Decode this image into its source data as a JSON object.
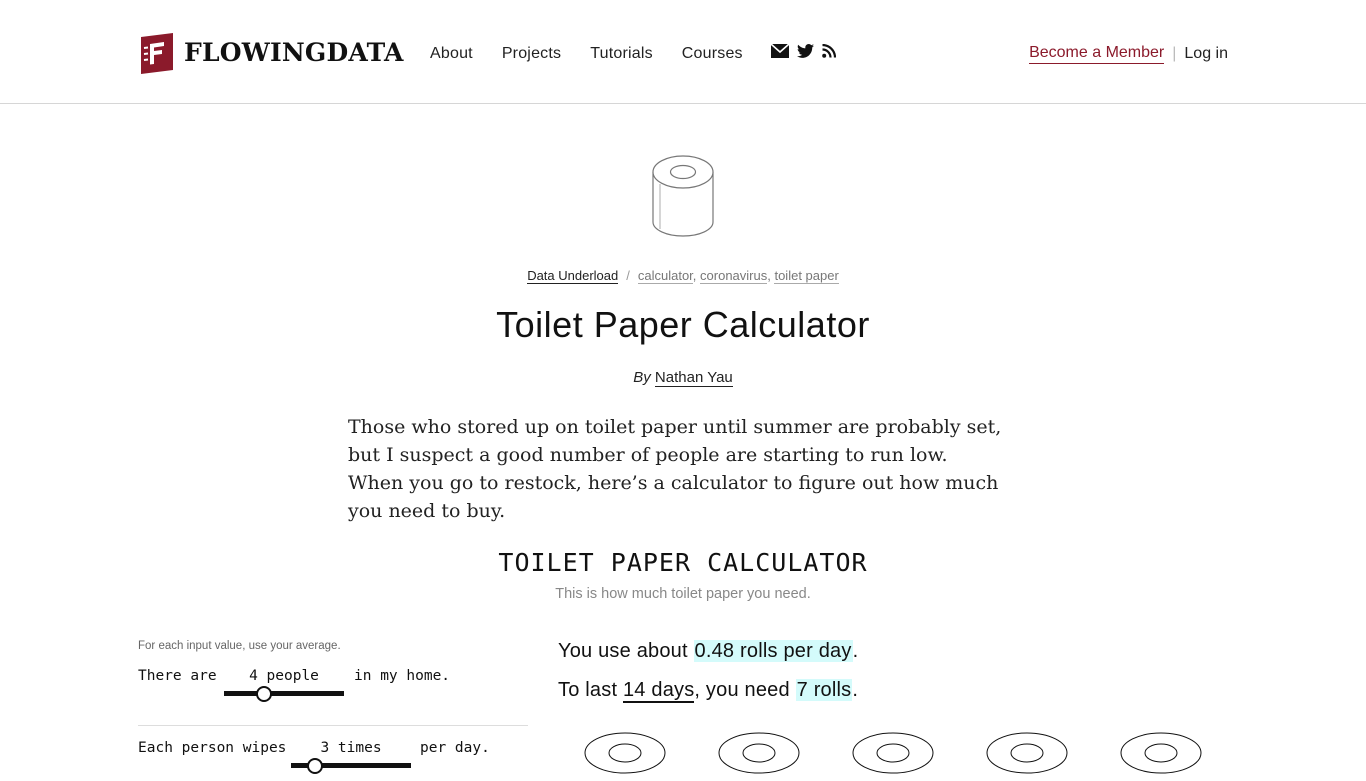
{
  "header": {
    "logo_text": "FLOWINGDATA",
    "nav": [
      "About",
      "Projects",
      "Tutorials",
      "Courses"
    ],
    "icons": [
      "mail-icon",
      "twitter-icon",
      "rss-icon"
    ],
    "become_member": "Become a Member",
    "separator": "|",
    "login": "Log in",
    "brand_color": "#8b1a2b"
  },
  "article": {
    "category": "Data Underload",
    "slash": "/",
    "tags": [
      "calculator",
      "coronavirus",
      "toilet paper"
    ],
    "title": "Toilet Paper Calculator",
    "by_label": "By",
    "author": "Nathan Yau",
    "intro": "Those who stored up on toilet paper until summer are probably set, but I suspect a good number of people are starting to run low. When you go to restock, here’s a calculator to figure out how much you need to buy."
  },
  "calculator": {
    "title": "TOILET PAPER CALCULATOR",
    "subtitle": "This is how much toilet paper you need.",
    "hint": "For each input value, use your average.",
    "people": {
      "pre": "There are",
      "value": "4 people",
      "post": "in my home.",
      "fraction": 0.33
    },
    "wipes": {
      "pre": "Each person wipes",
      "value": "3 times",
      "post": "per day.",
      "fraction": 0.2
    },
    "result1": {
      "pre": "You use about",
      "value": "0.48 rolls per day",
      "post": "."
    },
    "result2": {
      "pre": "To last",
      "days": "14 days",
      "mid": ", you need",
      "value": "7 rolls",
      "post": "."
    },
    "highlight_color": "#d4fbfb",
    "rolls_visible": 5
  }
}
